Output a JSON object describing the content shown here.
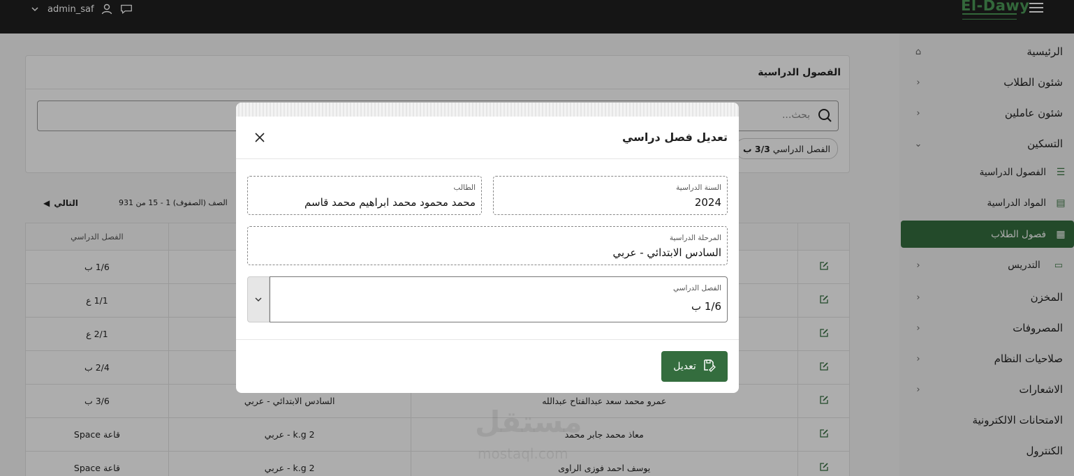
{
  "header": {
    "username": "admin_saf",
    "logo_text": "El-Dawy",
    "icons": [
      "chevron-down-icon",
      "user-icon",
      "chat-icon",
      "hamburger-menu-icon"
    ]
  },
  "sidebar": {
    "items": [
      {
        "label": "الرئيسية"
      },
      {
        "label": "شئون الطلاب"
      },
      {
        "label": "شئون عاملين"
      },
      {
        "label": "التسكين"
      },
      {
        "label": "الفصول الدراسية"
      },
      {
        "label": "المواد الدراسية"
      },
      {
        "label": "فصول الطلاب"
      },
      {
        "label": "التدريس"
      },
      {
        "label": "المخزن"
      },
      {
        "label": "المصروفات"
      },
      {
        "label": "صلاحيات النظام"
      },
      {
        "label": "الاشعارات"
      },
      {
        "label": "الامتحانات الالكترونية"
      },
      {
        "label": "الكنترول"
      }
    ],
    "active_item": "فصول الطلاب"
  },
  "main": {
    "card_title": "الفصول الدراسية",
    "search_placeholder": "بحث...",
    "filter_chip": {
      "label": "الفصل الدراسي",
      "value": "3/3 ب"
    },
    "pager": {
      "rows_label": "الصف (الصفوف) 1 - 15 من 931",
      "next_label": "التالي"
    },
    "table": {
      "headers": [
        "",
        "",
        "",
        "الفصل الدراسي"
      ],
      "rows": [
        {
          "student": "",
          "stage": "",
          "class": "1/6 ب"
        },
        {
          "student": "",
          "stage": "",
          "class": "1/1 ع"
        },
        {
          "student": "",
          "stage": "",
          "class": "2/1 ع"
        },
        {
          "student": "",
          "stage": "",
          "class": "2/4 ب"
        },
        {
          "student": "عمرو محمد سعد عبدالفتاح عبدالله",
          "stage": "السادس الابتدائي - عربي",
          "class": "3/6 ب"
        },
        {
          "student": "معاذ محمد جابر محمد",
          "stage": "k.g 2 - عربي",
          "class": "قاعة Space"
        },
        {
          "student": "يوسف احمد فوزى الراوى",
          "stage": "k.g 2 - عربي",
          "class": "قاعة Space"
        }
      ]
    },
    "watermark": {
      "text": "مستقل",
      "sub": "mostaql.com"
    }
  },
  "modal": {
    "title": "تعديل فصل دراسي",
    "fields": {
      "year": {
        "label": "السنة الدراسية",
        "value": "2024"
      },
      "student": {
        "label": "الطالب",
        "value": "محمد محمود محمد ابراهيم محمد قاسم"
      },
      "stage": {
        "label": "المرحلة الدراسية",
        "value": "السادس الابتدائي - عربي"
      },
      "class": {
        "label": "الفصل الدراسي",
        "value": "1/6 ب"
      }
    },
    "submit_label": "تعديل"
  },
  "colors": {
    "primary": "#346d3e",
    "topbar": "#1f1f1f",
    "logo": "#4c9a57"
  }
}
